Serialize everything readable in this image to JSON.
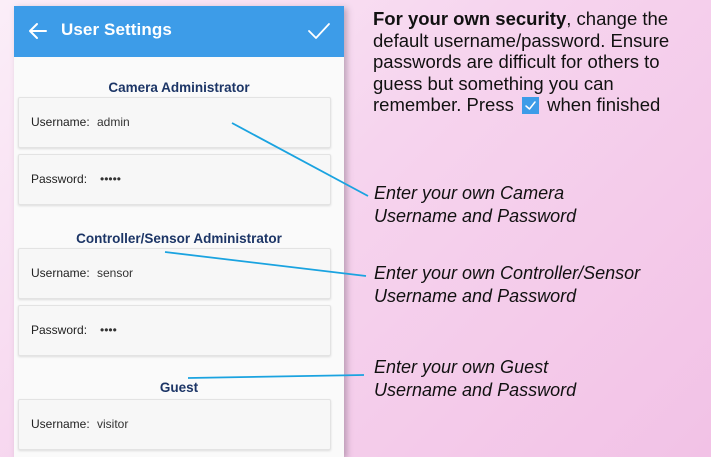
{
  "appbar": {
    "title": "User Settings"
  },
  "sections": {
    "camera": {
      "title": "Camera Administrator",
      "username_label": "Username:",
      "username_value": "admin",
      "password_label": "Password:",
      "password_value": "•••••"
    },
    "controller": {
      "title": "Controller/Sensor Administrator",
      "username_label": "Username:",
      "username_value": "sensor",
      "password_label": "Password:",
      "password_value": "••••"
    },
    "guest": {
      "title": "Guest",
      "username_label": "Username:",
      "username_value": "visitor"
    }
  },
  "instructions": {
    "bold": "For your own security",
    "line_part1": ", change the default username/password. Ensure passwords are difficult for others to guess but something you can remember. Press",
    "line_part2": "when finished"
  },
  "notes": {
    "camera_line1": "Enter your own Camera",
    "camera_line2": "Username and Password",
    "controller_line1": "Enter your own Controller/Sensor",
    "controller_line2": "Username and Password",
    "guest_line1": "Enter your own Guest",
    "guest_line2": "Username and Password"
  },
  "colors": {
    "appbar": "#3d9ce8",
    "section_title": "#1c3566",
    "callout_line": "#1aa3e0",
    "background": "#f6d4ee"
  },
  "icons": {
    "back": "arrow-left-icon",
    "confirm": "checkmark-icon"
  }
}
